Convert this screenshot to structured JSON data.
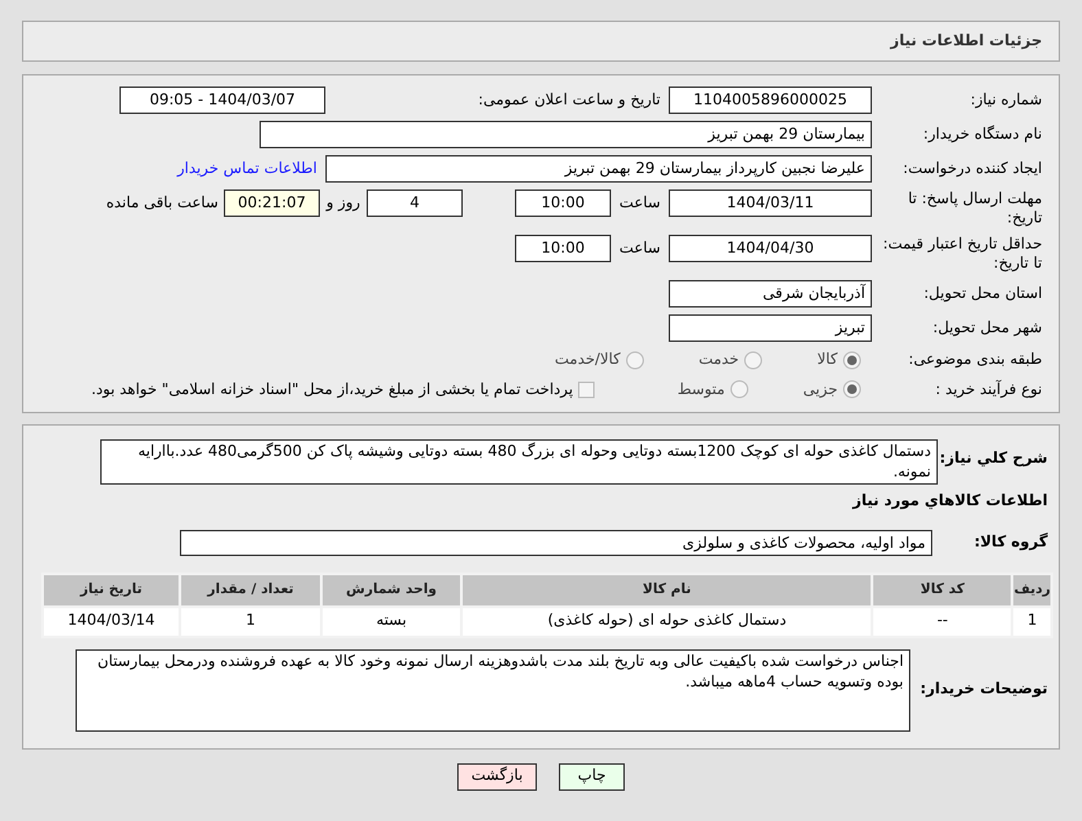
{
  "header": {
    "title": "جزئیات اطلاعات نیاز"
  },
  "need_number": {
    "label": "شماره نیاز:",
    "value": "1104005896000025"
  },
  "announce": {
    "label": "تاریخ و ساعت اعلان عمومی:",
    "value": "1404/03/07 - 09:05"
  },
  "buyer_org": {
    "label": "نام دستگاه خریدار:",
    "value": "بیمارستان 29 بهمن تبریز"
  },
  "requester": {
    "label": "ایجاد کننده درخواست:",
    "value": "علیرضا نجبین کارپرداز بیمارستان 29 بهمن تبریز",
    "link": "اطلاعات تماس خریدار"
  },
  "deadline": {
    "label": "مهلت ارسال پاسخ: تا تاریخ:",
    "date": "1404/03/11",
    "time_label": "ساعت",
    "time": "10:00",
    "days": "4",
    "days_label": "روز و",
    "remaining": "00:21:07",
    "remaining_label": "ساعت باقی مانده"
  },
  "validity": {
    "label": "حداقل تاریخ اعتبار قیمت: تا تاریخ:",
    "date": "1404/04/30",
    "time_label": "ساعت",
    "time": "10:00"
  },
  "province": {
    "label": "استان محل تحویل:",
    "value": "آذربایجان شرقی"
  },
  "city": {
    "label": "شهر محل تحویل:",
    "value": "تبریز"
  },
  "category": {
    "label": "طبقه بندی موضوعی:",
    "options": [
      {
        "label": "کالا",
        "selected": true
      },
      {
        "label": "خدمت",
        "selected": false
      },
      {
        "label": "کالا/خدمت",
        "selected": false
      }
    ]
  },
  "process": {
    "label": "نوع فرآیند خرید :",
    "options": [
      {
        "label": "جزیی",
        "selected": true
      },
      {
        "label": "متوسط",
        "selected": false
      }
    ],
    "checkbox": {
      "label": "پرداخت تمام یا بخشی از مبلغ خرید،از محل \"اسناد خزانه اسلامی\" خواهد بود.",
      "checked": false
    }
  },
  "description": {
    "label": "شرح کلي نياز:",
    "value": "دستمال کاغذی حوله ای کوچک 1200بسته دوتایی وحوله ای بزرگ 480 بسته دوتایی وشیشه پاک کن 500گرمی480 عدد.باارایه نمونه."
  },
  "goods_title": "اطلاعات کالاهاي مورد نياز",
  "goods_group": {
    "label": "گروه کالا:",
    "value": "مواد اولیه، محصولات کاغذی و سلولزی"
  },
  "table": {
    "columns": [
      "ردیف",
      "کد کالا",
      "نام کالا",
      "واحد شمارش",
      "تعداد / مقدار",
      "تاریخ نیاز"
    ],
    "rows": [
      [
        "1",
        "--",
        "دستمال کاغذی حوله ای (حوله کاغذی)",
        "بسته",
        "1",
        "1404/03/14"
      ]
    ]
  },
  "buyer_notes": {
    "label": "توضیحات خریدار:",
    "value": "اجناس درخواست شده باکیفیت عالی وبه تاریخ بلند مدت باشدوهزینه ارسال نمونه وخود کالا به عهده فروشنده ودرمحل بیمارستان بوده وتسویه حساب 4ماهه میباشد."
  },
  "buttons": [
    {
      "label": "چاپ",
      "kind": "print"
    },
    {
      "label": "بازگشت",
      "kind": "back"
    }
  ]
}
